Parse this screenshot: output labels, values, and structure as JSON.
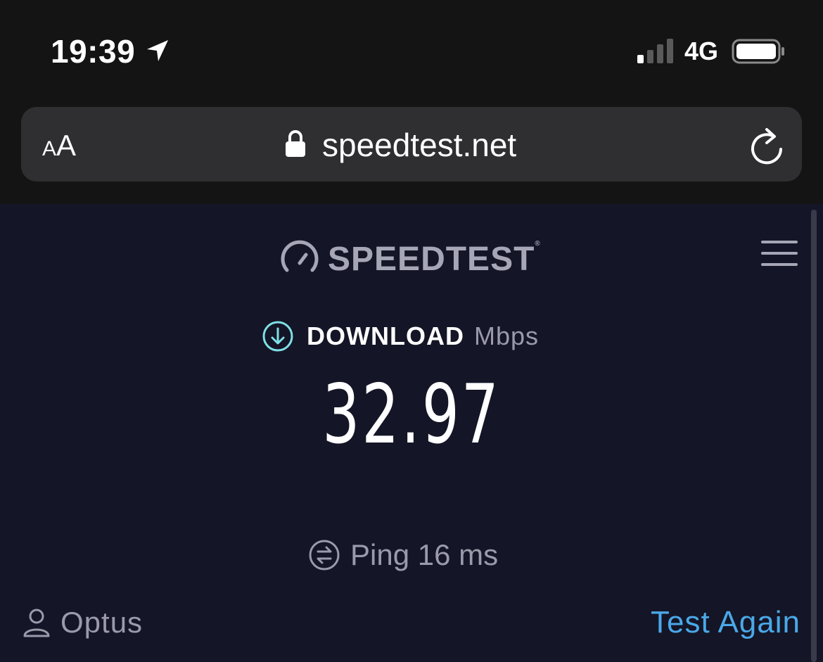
{
  "status_bar": {
    "time": "19:39",
    "network": "4G",
    "location_icon": "location-arrow-icon",
    "signal_icon": "cellular-signal-icon",
    "battery_icon": "battery-icon"
  },
  "browser": {
    "text_size_small": "A",
    "text_size_large": "A",
    "domain": "speedtest.net",
    "lock_icon": "lock-icon",
    "reload_icon": "reload-icon"
  },
  "header": {
    "brand": "SPEEDTEST",
    "brand_mark": "®",
    "logo_icon": "gauge-icon",
    "menu_icon": "hamburger-menu-icon"
  },
  "result": {
    "metric_label": "DOWNLOAD",
    "unit": "Mbps",
    "value": "32.97",
    "ping_text": "Ping 16 ms"
  },
  "footer": {
    "isp": "Optus",
    "test_again": "Test Again"
  },
  "colors": {
    "page_background": "#141526",
    "accent_link": "#4aa8e8",
    "download_icon": "#7ee0e6",
    "muted_text": "#9a9aaa"
  }
}
